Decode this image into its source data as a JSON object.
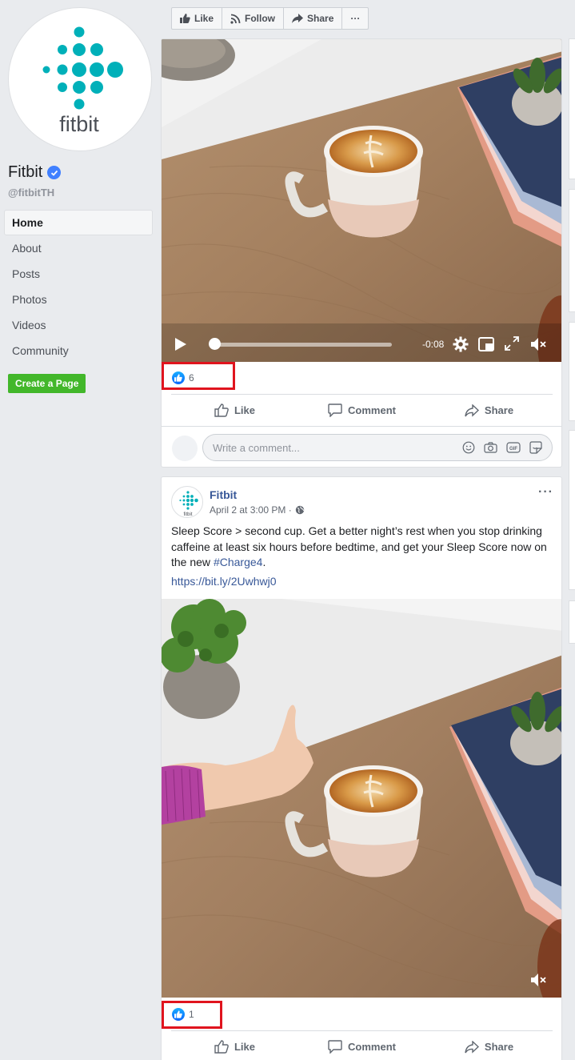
{
  "page": {
    "name": "Fitbit",
    "handle": "@fitbitTH",
    "logo_text": "fitbit"
  },
  "nav": {
    "items": [
      {
        "label": "Home",
        "active": true
      },
      {
        "label": "About"
      },
      {
        "label": "Posts"
      },
      {
        "label": "Photos"
      },
      {
        "label": "Videos"
      },
      {
        "label": "Community"
      }
    ],
    "create_page_label": "Create a Page"
  },
  "action_bar": {
    "like_label": "Like",
    "follow_label": "Follow",
    "share_label": "Share",
    "more_label": "···"
  },
  "post1": {
    "video_time": "-0:08",
    "reaction_count": "6",
    "ufi": {
      "like": "Like",
      "comment": "Comment",
      "share": "Share"
    },
    "comment_placeholder": "Write a comment..."
  },
  "post2": {
    "author": "Fitbit",
    "timestamp": "April 2 at 3:00 PM ·",
    "text_main": "Sleep Score > second cup. Get a better night’s rest when you stop drinking caffeine at least six hours before bedtime, and get your Sleep Score now on the new ",
    "hashtag": "#Charge4",
    "text_end": ".",
    "link": "https://bit.ly/2Uwhwj0",
    "reaction_count": "1",
    "ufi": {
      "like": "Like",
      "comment": "Comment",
      "share": "Share"
    }
  },
  "colors": {
    "brand_teal": "#00b0b9",
    "link_blue": "#385898",
    "create_green": "#42b72a",
    "highlight_red": "#e0141e"
  }
}
